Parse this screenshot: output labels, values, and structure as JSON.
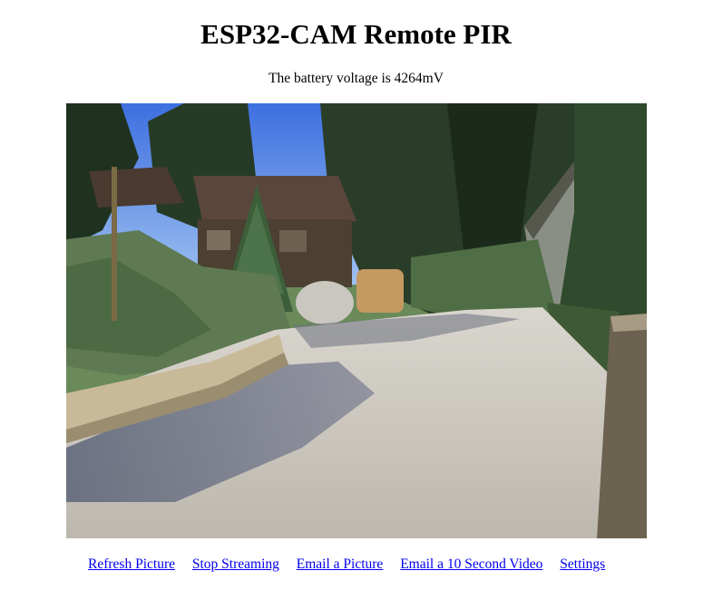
{
  "title": "ESP32-CAM Remote PIR",
  "battery_text": "The battery voltage is 4264mV",
  "camera_image": {
    "description_icon": "camera-snapshot-icon"
  },
  "links": [
    {
      "label": "Refresh Picture"
    },
    {
      "label": "Stop Streaming"
    },
    {
      "label": "Email a Picture"
    },
    {
      "label": "Email a 10 Second Video"
    },
    {
      "label": "Settings"
    }
  ],
  "colors": {
    "link": "#0000ee",
    "text": "#000000",
    "background": "#ffffff"
  }
}
